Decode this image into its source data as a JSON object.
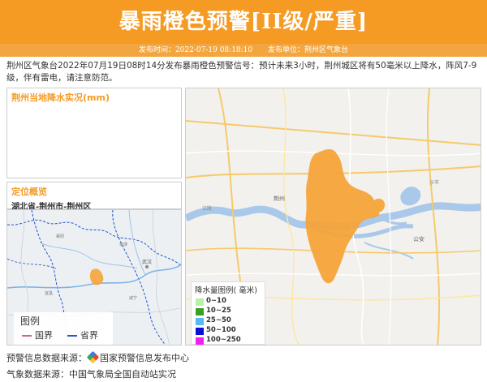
{
  "header": {
    "title": "暴雨橙色预警[II级/严重]",
    "publish_time_label": "发布时间：2022-07-19 08:18:10",
    "publisher_label": "发布单位：荆州区气象台"
  },
  "summary": "荆州区气象台2022年07月19日08时14分发布暴雨橙色预警信号：预计未来3小时，荆州城区将有50毫米以上降水，阵风7-9级，伴有雷电，请注意防范。",
  "rain_panel": {
    "title": "荆州当地降水实况(mm)"
  },
  "location_panel": {
    "title": "定位概览",
    "location": "湖北省-荆州市-荆州区"
  },
  "mini_map_legend": {
    "title": "图例",
    "items": [
      {
        "label": "国界",
        "color": "#c4627a"
      },
      {
        "label": "省界",
        "color": "#1e50c8"
      }
    ]
  },
  "rain_legend": {
    "title": "降水量图例( 毫米)",
    "items": [
      {
        "label": "0~10",
        "color": "#b7f0a8"
      },
      {
        "label": "10~25",
        "color": "#3aa01f"
      },
      {
        "label": "25~50",
        "color": "#57b8f5"
      },
      {
        "label": "50~100",
        "color": "#0a10d8"
      },
      {
        "label": "100~250",
        "color": "#f020f0"
      }
    ]
  },
  "sources": {
    "warning_source_label": "预警信息数据来源：",
    "warning_source_value": "国家预警信息发布中心",
    "weather_source_label": "气象数据来源：",
    "weather_source_value": "中国气象局全国自动站实况"
  },
  "colors": {
    "banner": "#f59a23",
    "warning_area": "#f5a43a"
  }
}
